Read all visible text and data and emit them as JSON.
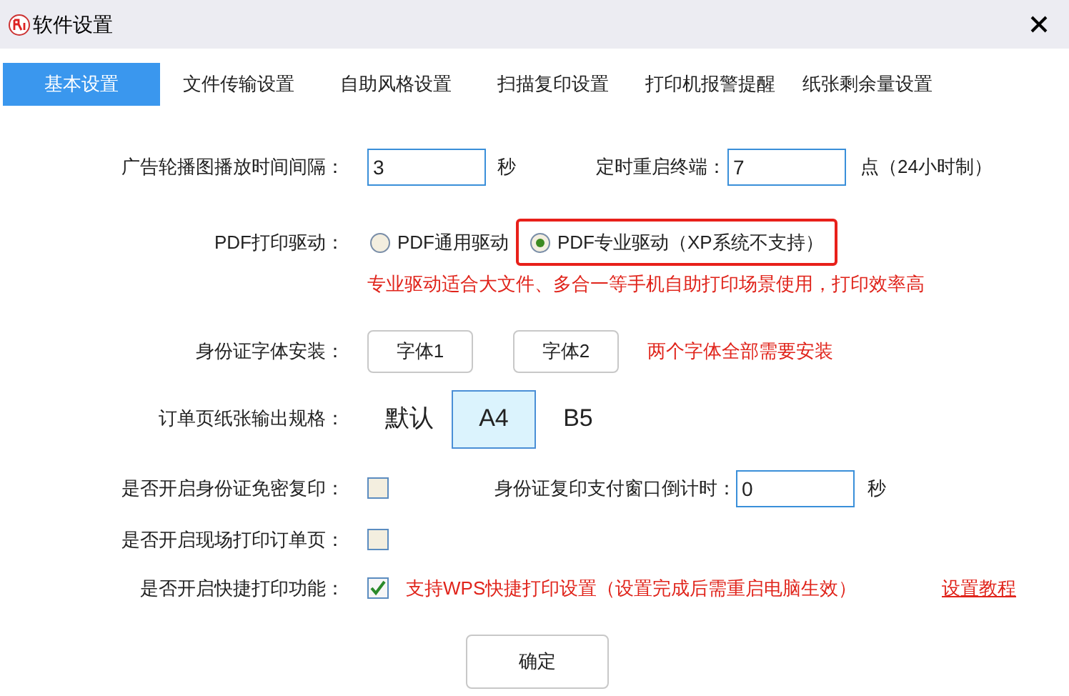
{
  "window": {
    "title": "软件设置"
  },
  "tabs": [
    {
      "label": "基本设置",
      "selected": true
    },
    {
      "label": "文件传输设置",
      "selected": false
    },
    {
      "label": "自助风格设置",
      "selected": false
    },
    {
      "label": "扫描复印设置",
      "selected": false
    },
    {
      "label": "打印机报警提醒",
      "selected": false
    },
    {
      "label": "纸张剩余量设置",
      "selected": false
    }
  ],
  "ad_interval": {
    "label": "广告轮播图播放时间间隔：",
    "value": "3",
    "unit": "秒"
  },
  "restart": {
    "label": "定时重启终端：",
    "value": "7",
    "unit": "点（24小时制）"
  },
  "pdf_driver": {
    "label": "PDF打印驱动：",
    "options": [
      {
        "label": "PDF通用驱动",
        "selected": false,
        "highlighted": false
      },
      {
        "label": "PDF专业驱动（XP系统不支持）",
        "selected": true,
        "highlighted": true
      }
    ],
    "note": "专业驱动适合大文件、多合一等手机自助打印场景使用，打印效率高"
  },
  "font_install": {
    "label": "身份证字体安装：",
    "buttons": [
      "字体1",
      "字体2"
    ],
    "note": "两个字体全部需要安装"
  },
  "paper_size": {
    "label": "订单页纸张输出规格：",
    "options": [
      {
        "label": "默认",
        "selected": false
      },
      {
        "label": "A4",
        "selected": true
      },
      {
        "label": "B5",
        "selected": false
      }
    ]
  },
  "id_free_copy": {
    "label": "是否开启身份证免密复印：",
    "checked": false
  },
  "countdown": {
    "label": "身份证复印支付窗口倒计时：",
    "value": "0",
    "unit": "秒"
  },
  "onsite_print": {
    "label": "是否开启现场打印订单页：",
    "checked": false
  },
  "quick_print": {
    "label": "是否开启快捷打印功能：",
    "checked": true,
    "note": "支持WPS快捷打印设置（设置完成后需重启电脑生效）",
    "link": "设置教程"
  },
  "confirm_button": "确定"
}
